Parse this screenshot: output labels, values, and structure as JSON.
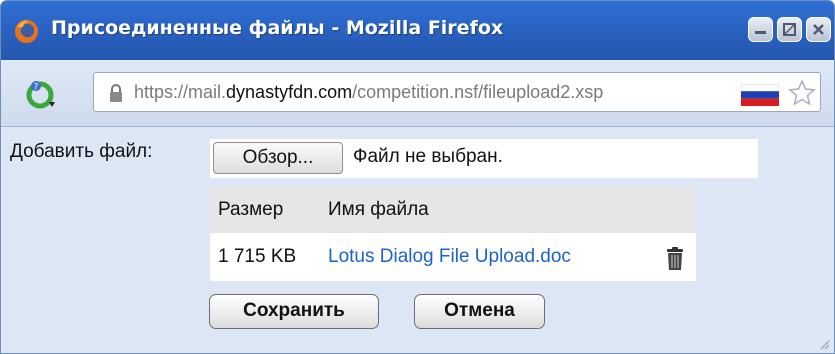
{
  "window": {
    "title": "Присоединенные файлы - Mozilla Firefox"
  },
  "navbar": {
    "url_prefix": "https://mail.",
    "url_domain": "dynastyfdn.com",
    "url_path": "/competition.nsf/fileupload2.xsp"
  },
  "form": {
    "add_file_label": "Добавить файл:",
    "browse_label": "Обзор...",
    "no_file_text": "Файл не выбран."
  },
  "table": {
    "headers": [
      "Размер",
      "Имя файла"
    ],
    "rows": [
      {
        "size": "1 715 KB",
        "name": "Lotus Dialog File Upload.doc"
      }
    ]
  },
  "buttons": {
    "save": "Сохранить",
    "cancel": "Отмена"
  },
  "colors": {
    "titlebar": "#2a63c2",
    "content_bg": "#dce6f5",
    "link": "#1e63c7"
  },
  "icons": [
    "firefox-icon",
    "minimize-icon",
    "maximize-icon",
    "close-icon",
    "site-identity-icon",
    "lock-icon",
    "russian-flag-icon",
    "bookmark-star-icon",
    "trash-icon",
    "resize-grip-icon"
  ]
}
